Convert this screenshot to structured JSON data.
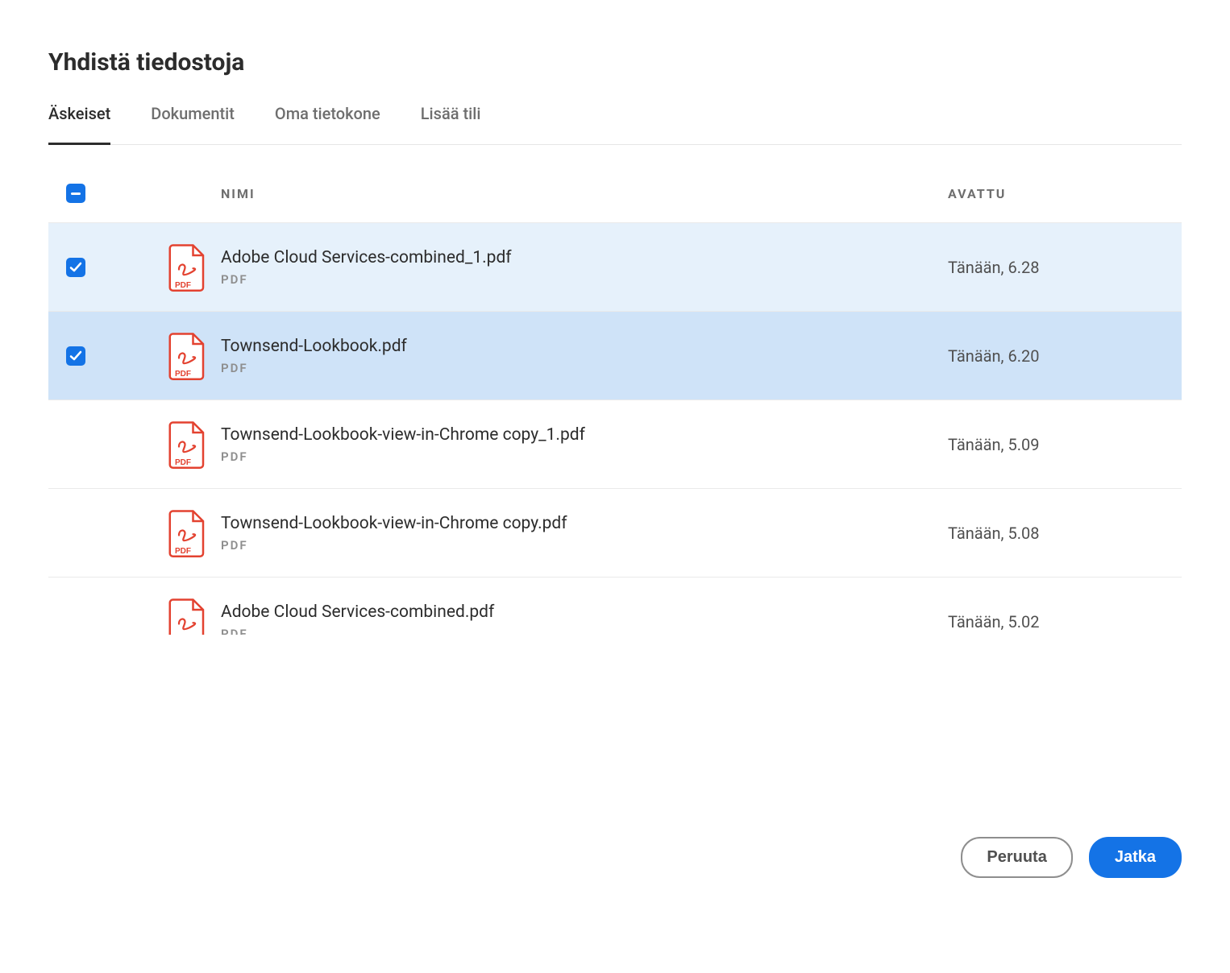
{
  "title": "Yhdistä tiedostoja",
  "tabs": [
    {
      "label": "Äskeiset",
      "active": true
    },
    {
      "label": "Dokumentit",
      "active": false
    },
    {
      "label": "Oma tietokone",
      "active": false
    },
    {
      "label": "Lisää tili",
      "active": false
    }
  ],
  "columns": {
    "name": "NIMI",
    "opened": "AVATTU"
  },
  "select_all_state": "indeterminate",
  "file_type_label": "PDF",
  "files": [
    {
      "name": "Adobe Cloud Services-combined_1.pdf",
      "opened": "Tänään, 6.28",
      "selected": true,
      "highlight": "light"
    },
    {
      "name": "Townsend-Lookbook.pdf",
      "opened": "Tänään, 6.20",
      "selected": true,
      "highlight": "strong"
    },
    {
      "name": "Townsend-Lookbook-view-in-Chrome copy_1.pdf",
      "opened": "Tänään, 5.09",
      "selected": false,
      "highlight": "none"
    },
    {
      "name": "Townsend-Lookbook-view-in-Chrome copy.pdf",
      "opened": "Tänään, 5.08",
      "selected": false,
      "highlight": "none"
    },
    {
      "name": "Adobe Cloud Services-combined.pdf",
      "opened": "Tänään, 5.02",
      "selected": false,
      "highlight": "none"
    }
  ],
  "buttons": {
    "cancel": "Peruuta",
    "continue": "Jatka"
  }
}
